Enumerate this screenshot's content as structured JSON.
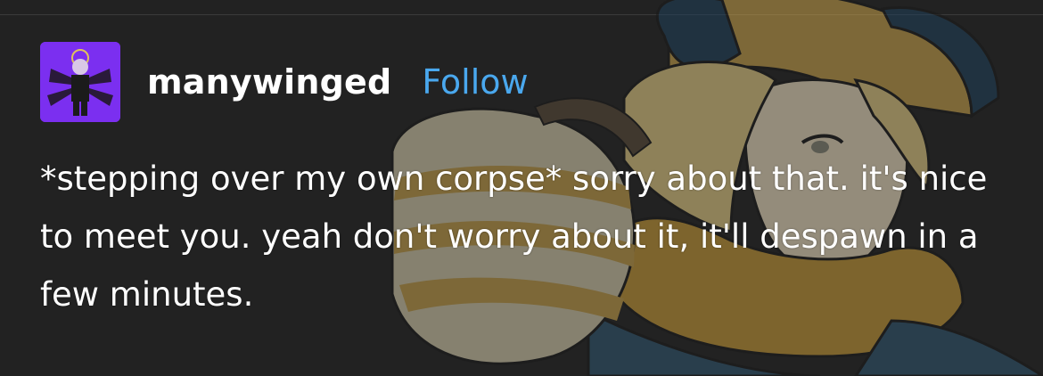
{
  "post": {
    "username": "manywinged",
    "follow_label": "Follow",
    "body_text": "*stepping over my own corpse* sorry about that. it's nice to meet you. yeah don't worry about it, it'll despawn in a few minutes."
  },
  "colors": {
    "background": "#222222",
    "avatar_background": "#7b2ff0",
    "follow_link": "#4aa8ee",
    "text": "#ffffff"
  },
  "icons": {
    "avatar": "user-avatar-icon",
    "background_art": "character-illustration"
  }
}
